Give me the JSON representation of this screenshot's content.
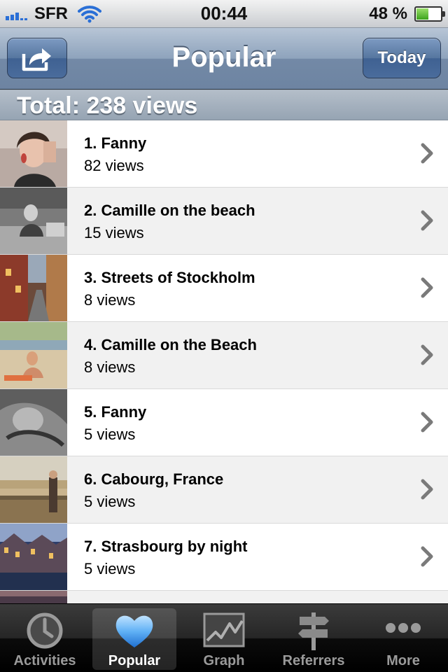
{
  "status_bar": {
    "carrier": "SFR",
    "time": "00:44",
    "battery_percent_text": "48 %",
    "battery_level": 0.48,
    "signal_bars": 3
  },
  "nav_bar": {
    "title": "Popular",
    "share_icon": "share-icon",
    "right_button_label": "Today"
  },
  "section": {
    "title": "Total: 238 views"
  },
  "items": [
    {
      "title": "1. Fanny",
      "views": "82 views"
    },
    {
      "title": "2. Camille on the beach",
      "views": "15 views"
    },
    {
      "title": "3. Streets of Stockholm",
      "views": "8 views"
    },
    {
      "title": "4. Camille on the Beach",
      "views": "8 views"
    },
    {
      "title": "5. Fanny",
      "views": "5 views"
    },
    {
      "title": "6. Cabourg, France",
      "views": "5 views"
    },
    {
      "title": "7. Strasbourg by night",
      "views": "5 views"
    }
  ],
  "tabs": [
    {
      "label": "Activities",
      "icon": "clock-icon",
      "selected": false
    },
    {
      "label": "Popular",
      "icon": "heart-icon",
      "selected": true
    },
    {
      "label": "Graph",
      "icon": "line-graph-icon",
      "selected": false
    },
    {
      "label": "Referrers",
      "icon": "signpost-icon",
      "selected": false
    },
    {
      "label": "More",
      "icon": "more-dots-icon",
      "selected": false
    }
  ],
  "colors": {
    "nav_bar": "#7389a6",
    "button": "#4a6c9c",
    "tab_selected": "#ffffff",
    "tab_unselected": "#9a9a9a",
    "heart": "#3a8ee6"
  }
}
